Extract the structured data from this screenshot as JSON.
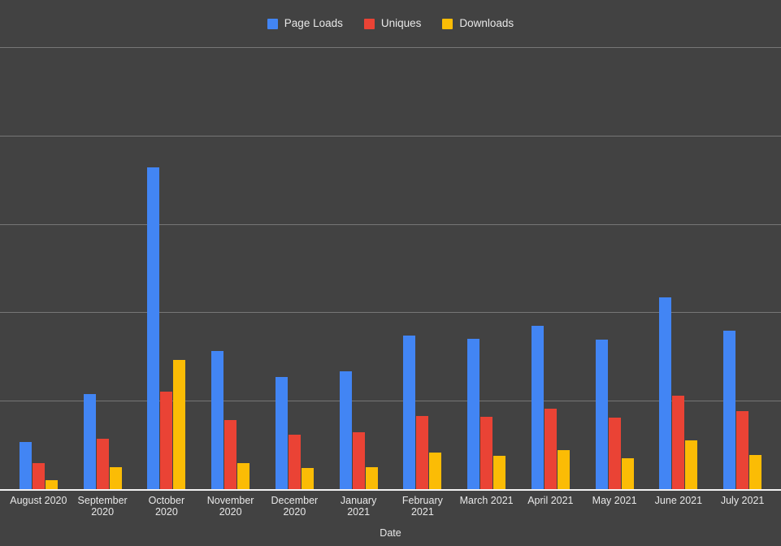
{
  "chart_data": {
    "type": "bar",
    "title": "",
    "xlabel": "Date",
    "ylabel": "",
    "grid": true,
    "legend_position": "top",
    "ylim": [
      0,
      2500
    ],
    "y_gridline_values": [
      0,
      500,
      1000,
      1500,
      2000,
      2500
    ],
    "y_tick_labels_shown": false,
    "categories": [
      "August 2020",
      "September 2020",
      "October 2020",
      "November 2020",
      "December 2020",
      "January 2021",
      "February 2021",
      "March 2021",
      "April 2021",
      "May 2021",
      "June 2021",
      "July 2021"
    ],
    "category_lines": [
      [
        "August 2020"
      ],
      [
        "September",
        "2020"
      ],
      [
        "October",
        "2020"
      ],
      [
        "November",
        "2020"
      ],
      [
        "December",
        "2020"
      ],
      [
        "January",
        "2021"
      ],
      [
        "February",
        "2021"
      ],
      [
        "March 2021"
      ],
      [
        "April 2021"
      ],
      [
        "May 2021"
      ],
      [
        "June 2021"
      ],
      [
        "July 2021"
      ]
    ],
    "series": [
      {
        "name": "Page Loads",
        "color": "#4285F4",
        "values": [
          265,
          540,
          1820,
          780,
          635,
          665,
          870,
          850,
          925,
          845,
          1085,
          895
        ]
      },
      {
        "name": "Uniques",
        "color": "#EA4335",
        "values": [
          145,
          285,
          550,
          390,
          310,
          320,
          415,
          410,
          455,
          405,
          530,
          440
        ]
      },
      {
        "name": "Downloads",
        "color": "#FBBC05",
        "values": [
          50,
          122,
          730,
          145,
          120,
          126,
          206,
          188,
          222,
          173,
          276,
          195
        ]
      }
    ]
  },
  "legend": {
    "items": [
      {
        "label": "Page Loads",
        "color": "#4285F4"
      },
      {
        "label": "Uniques",
        "color": "#EA4335"
      },
      {
        "label": "Downloads",
        "color": "#FBBC05"
      }
    ]
  },
  "axis": {
    "x_title": "Date"
  },
  "style": {
    "background": "#424242",
    "gridline_color": "#8a8a8a",
    "baseline_color": "#f2f2f2",
    "text_color": "#e8e8e8"
  }
}
